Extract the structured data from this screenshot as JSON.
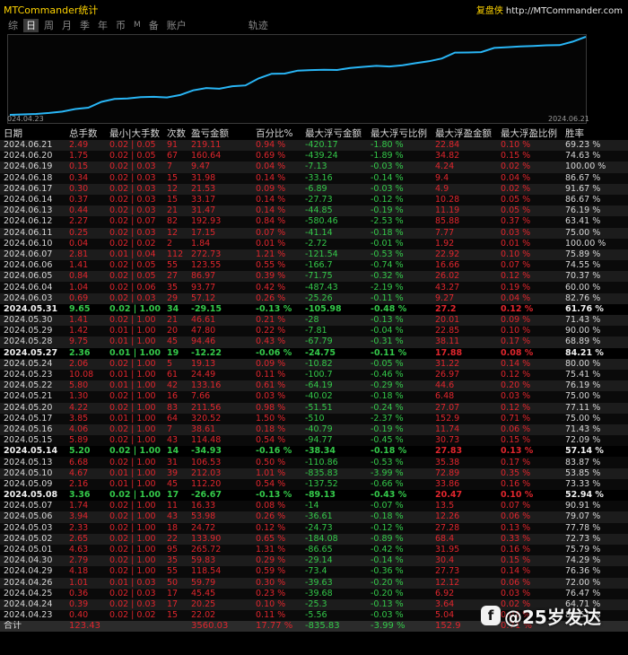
{
  "header": {
    "app_title": "MTCommander统计",
    "brand_cn": "复盘侠",
    "brand_url": "http://MTCommander.com"
  },
  "tabs": [
    {
      "label": "综",
      "active": false
    },
    {
      "label": "日",
      "active": true
    },
    {
      "label": "周",
      "active": false
    },
    {
      "label": "月",
      "active": false
    },
    {
      "label": "季",
      "active": false
    },
    {
      "label": "年",
      "active": false
    },
    {
      "label": "币",
      "active": false
    },
    {
      "label": "M",
      "active": false
    },
    {
      "label": "备",
      "active": false
    },
    {
      "label": "账户",
      "active": false
    },
    {
      "label": "轨迹",
      "active": false
    }
  ],
  "chart_data": {
    "type": "line",
    "x_start_label": "024.04.23",
    "x_end_label": "2024.06.21",
    "line_color": "#29b6f6",
    "note_values_are_cumulative_profit": true
  },
  "table": {
    "columns": [
      "日期",
      "总手数",
      "最小|大手数",
      "次数",
      "盈亏金额",
      "百分比%",
      "最大浮亏金额",
      "最大浮亏比例",
      "最大浮盈金额",
      "最大浮盈比例",
      "胜率"
    ],
    "rows": [
      [
        "2024.06.21",
        "2.49",
        "0.02 | 0.05",
        "91",
        "219.11",
        "0.94 %",
        "-420.17",
        "-1.80 %",
        "22.84",
        "0.10 %",
        "69.23 %"
      ],
      [
        "2024.06.20",
        "1.75",
        "0.02 | 0.05",
        "67",
        "160.64",
        "0.69 %",
        "-439.24",
        "-1.89 %",
        "34.82",
        "0.15 %",
        "74.63 %"
      ],
      [
        "2024.06.19",
        "0.15",
        "0.02 | 0.03",
        "7",
        "9.47",
        "0.04 %",
        "-7.13",
        "-0.03 %",
        "4.24",
        "0.02 %",
        "100.00 %"
      ],
      [
        "2024.06.18",
        "0.34",
        "0.02 | 0.03",
        "15",
        "31.98",
        "0.14 %",
        "-33.16",
        "-0.14 %",
        "9.4",
        "0.04 %",
        "86.67 %"
      ],
      [
        "2024.06.17",
        "0.30",
        "0.02 | 0.03",
        "12",
        "21.53",
        "0.09 %",
        "-6.89",
        "-0.03 %",
        "4.9",
        "0.02 %",
        "91.67 %"
      ],
      [
        "2024.06.14",
        "0.37",
        "0.02 | 0.03",
        "15",
        "33.17",
        "0.14 %",
        "-27.73",
        "-0.12 %",
        "10.28",
        "0.05 %",
        "86.67 %"
      ],
      [
        "2024.06.13",
        "0.44",
        "0.02 | 0.03",
        "21",
        "31.47",
        "0.14 %",
        "-44.85",
        "-0.19 %",
        "11.19",
        "0.05 %",
        "76.19 %"
      ],
      [
        "2024.06.12",
        "2.27",
        "0.02 | 0.07",
        "82",
        "192.93",
        "0.84 %",
        "-580.46",
        "-2.53 %",
        "85.88",
        "0.37 %",
        "63.41 %"
      ],
      [
        "2024.06.11",
        "0.25",
        "0.02 | 0.03",
        "12",
        "17.15",
        "0.07 %",
        "-41.14",
        "-0.18 %",
        "7.77",
        "0.03 %",
        "75.00 %"
      ],
      [
        "2024.06.10",
        "0.04",
        "0.02 | 0.02",
        "2",
        "1.84",
        "0.01 %",
        "-2.72",
        "-0.01 %",
        "1.92",
        "0.01 %",
        "100.00 %"
      ],
      [
        "2024.06.07",
        "2.81",
        "0.01 | 0.04",
        "112",
        "272.73",
        "1.21 %",
        "-121.54",
        "-0.53 %",
        "22.92",
        "0.10 %",
        "75.89 %"
      ],
      [
        "2024.06.06",
        "1.41",
        "0.02 | 0.05",
        "55",
        "123.55",
        "0.55 %",
        "-166.7",
        "-0.74 %",
        "16.66",
        "0.07 %",
        "74.55 %"
      ],
      [
        "2024.06.05",
        "0.84",
        "0.02 | 0.05",
        "27",
        "86.97",
        "0.39 %",
        "-71.75",
        "-0.32 %",
        "26.02",
        "0.12 %",
        "70.37 %"
      ],
      [
        "2024.06.04",
        "1.04",
        "0.02 | 0.06",
        "35",
        "93.77",
        "0.42 %",
        "-487.43",
        "-2.19 %",
        "43.27",
        "0.19 %",
        "60.00 %"
      ],
      [
        "2024.06.03",
        "0.69",
        "0.02 | 0.03",
        "29",
        "57.12",
        "0.26 %",
        "-25.26",
        "-0.11 %",
        "9.27",
        "0.04 %",
        "82.76 %"
      ],
      [
        "2024.05.31",
        "9.65",
        "0.02 | 1.00",
        "34",
        "-29.15",
        "-0.13 %",
        "-105.98",
        "-0.48 %",
        "27.2",
        "0.12 %",
        "61.76 %"
      ],
      [
        "2024.05.30",
        "1.41",
        "0.02 | 1.00",
        "21",
        "46.61",
        "0.21 %",
        "-28",
        "-0.13 %",
        "20.01",
        "0.09 %",
        "71.43 %"
      ],
      [
        "2024.05.29",
        "1.42",
        "0.01 | 1.00",
        "20",
        "47.80",
        "0.22 %",
        "-7.81",
        "-0.04 %",
        "22.85",
        "0.10 %",
        "90.00 %"
      ],
      [
        "2024.05.28",
        "9.75",
        "0.01 | 1.00",
        "45",
        "94.46",
        "0.43 %",
        "-67.79",
        "-0.31 %",
        "38.11",
        "0.17 %",
        "68.89 %"
      ],
      [
        "2024.05.27",
        "2.36",
        "0.01 | 1.00",
        "19",
        "-12.22",
        "-0.06 %",
        "-24.75",
        "-0.11 %",
        "17.88",
        "0.08 %",
        "84.21 %"
      ],
      [
        "2024.05.24",
        "2.06",
        "0.02 | 1.00",
        "5",
        "19.13",
        "0.09 %",
        "-10.82",
        "-0.05 %",
        "31.22",
        "0.14 %",
        "80.00 %"
      ],
      [
        "2024.05.23",
        "10.08",
        "0.01 | 1.00",
        "61",
        "24.49",
        "0.11 %",
        "-100.7",
        "-0.46 %",
        "26.97",
        "0.12 %",
        "75.41 %"
      ],
      [
        "2024.05.22",
        "5.80",
        "0.01 | 1.00",
        "42",
        "133.16",
        "0.61 %",
        "-64.19",
        "-0.29 %",
        "44.6",
        "0.20 %",
        "76.19 %"
      ],
      [
        "2024.05.21",
        "1.30",
        "0.02 | 1.00",
        "16",
        "7.66",
        "0.03 %",
        "-40.02",
        "-0.18 %",
        "6.48",
        "0.03 %",
        "75.00 %"
      ],
      [
        "2024.05.20",
        "4.22",
        "0.02 | 1.00",
        "83",
        "211.56",
        "0.98 %",
        "-51.51",
        "-0.24 %",
        "27.07",
        "0.12 %",
        "77.11 %"
      ],
      [
        "2024.05.17",
        "3.85",
        "0.01 | 1.00",
        "64",
        "320.52",
        "1.50 %",
        "-510",
        "-2.37 %",
        "152.9",
        "0.71 %",
        "75.00 %"
      ],
      [
        "2024.05.16",
        "4.06",
        "0.02 | 1.00",
        "7",
        "38.61",
        "0.18 %",
        "-40.79",
        "-0.19 %",
        "11.74",
        "0.06 %",
        "71.43 %"
      ],
      [
        "2024.05.15",
        "5.89",
        "0.02 | 1.00",
        "43",
        "114.48",
        "0.54 %",
        "-94.77",
        "-0.45 %",
        "30.73",
        "0.15 %",
        "72.09 %"
      ],
      [
        "2024.05.14",
        "5.20",
        "0.02 | 1.00",
        "14",
        "-34.93",
        "-0.16 %",
        "-38.34",
        "-0.18 %",
        "27.83",
        "0.13 %",
        "57.14 %"
      ],
      [
        "2024.05.13",
        "6.68",
        "0.02 | 1.00",
        "31",
        "106.53",
        "0.50 %",
        "-110.86",
        "-0.53 %",
        "35.38",
        "0.17 %",
        "83.87 %"
      ],
      [
        "2024.05.10",
        "4.67",
        "0.01 | 1.00",
        "39",
        "212.03",
        "1.01 %",
        "-835.83",
        "-3.99 %",
        "72.89",
        "0.35 %",
        "53.85 %"
      ],
      [
        "2024.05.09",
        "2.16",
        "0.01 | 1.00",
        "45",
        "112.20",
        "0.54 %",
        "-137.52",
        "-0.66 %",
        "33.86",
        "0.16 %",
        "73.33 %"
      ],
      [
        "2024.05.08",
        "3.36",
        "0.02 | 1.00",
        "17",
        "-26.67",
        "-0.13 %",
        "-89.13",
        "-0.43 %",
        "20.47",
        "0.10 %",
        "52.94 %"
      ],
      [
        "2024.05.07",
        "1.74",
        "0.02 | 1.00",
        "11",
        "16.33",
        "0.08 %",
        "-14",
        "-0.07 %",
        "13.5",
        "0.07 %",
        "90.91 %"
      ],
      [
        "2024.05.06",
        "3.94",
        "0.02 | 1.00",
        "43",
        "53.98",
        "0.26 %",
        "-36.61",
        "-0.18 %",
        "12.26",
        "0.06 %",
        "79.07 %"
      ],
      [
        "2024.05.03",
        "2.33",
        "0.02 | 1.00",
        "18",
        "24.72",
        "0.12 %",
        "-24.73",
        "-0.12 %",
        "27.28",
        "0.13 %",
        "77.78 %"
      ],
      [
        "2024.05.02",
        "2.65",
        "0.02 | 1.00",
        "22",
        "133.90",
        "0.65 %",
        "-184.08",
        "-0.89 %",
        "68.4",
        "0.33 %",
        "72.73 %"
      ],
      [
        "2024.05.01",
        "4.63",
        "0.02 | 1.00",
        "95",
        "265.72",
        "1.31 %",
        "-86.65",
        "-0.42 %",
        "31.95",
        "0.16 %",
        "75.79 %"
      ],
      [
        "2024.04.30",
        "2.79",
        "0.02 | 1.00",
        "35",
        "59.83",
        "0.29 %",
        "-29.14",
        "-0.14 %",
        "30.4",
        "0.15 %",
        "74.29 %"
      ],
      [
        "2024.04.29",
        "4.18",
        "0.02 | 1.00",
        "55",
        "118.54",
        "0.59 %",
        "-73.4",
        "-0.36 %",
        "27.73",
        "0.14 %",
        "76.36 %"
      ],
      [
        "2024.04.26",
        "1.01",
        "0.01 | 0.03",
        "50",
        "59.79",
        "0.30 %",
        "-39.63",
        "-0.20 %",
        "12.12",
        "0.06 %",
        "72.00 %"
      ],
      [
        "2024.04.25",
        "0.36",
        "0.02 | 0.03",
        "17",
        "45.45",
        "0.23 %",
        "-39.68",
        "-0.20 %",
        "6.92",
        "0.03 %",
        "76.47 %"
      ],
      [
        "2024.04.24",
        "0.39",
        "0.02 | 0.03",
        "17",
        "20.25",
        "0.10 %",
        "-25.3",
        "-0.13 %",
        "3.64",
        "0.02 %",
        "64.71 %"
      ],
      [
        "2024.04.23",
        "0.40",
        "0.02 | 0.02",
        "15",
        "22.02",
        "0.11 %",
        "-5.56",
        "-0.03 %",
        "5.04",
        "0.03 %",
        "86.67 %"
      ]
    ],
    "highlight_dates": [
      "2024.05.31",
      "2024.05.27",
      "2024.05.14",
      "2024.05.08"
    ],
    "totals": {
      "label": "合计",
      "total_lots": "123.43",
      "profit": "3560.03",
      "percent": "17.77 %",
      "max_float_loss": "-835.83",
      "max_float_loss_pct": "-3.99 %",
      "max_float_profit": "152.9",
      "max_float_profit_pct": "0.71 %"
    }
  },
  "watermark": {
    "logo": "f",
    "text": "@25岁发达"
  }
}
